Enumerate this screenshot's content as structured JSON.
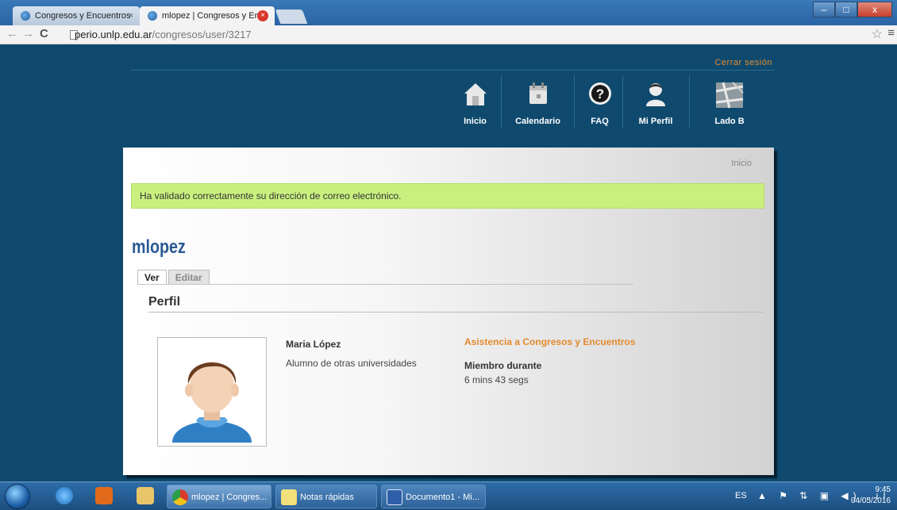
{
  "browser": {
    "tabs": [
      {
        "title": "Congresos y Encuentros",
        "close": "×"
      },
      {
        "title": "mlopez | Congresos y Enc",
        "close": "×"
      }
    ],
    "window_controls": {
      "minimize": "–",
      "maximize": "□",
      "close": "x"
    },
    "nav": {
      "back": "←",
      "forward": "→",
      "reload": "C"
    },
    "url_host": "perio.unlp.edu.ar",
    "url_path": "/congresos/user/3217",
    "star": "☆",
    "menu": "≡"
  },
  "site": {
    "logout": "Cerrar sesión",
    "nav": [
      {
        "label": "Inicio",
        "icon": "home-icon"
      },
      {
        "label": "Calendario",
        "icon": "calendar-icon"
      },
      {
        "label": "FAQ",
        "icon": "help-icon"
      },
      {
        "label": "Mi Perfil",
        "icon": "user-icon"
      },
      {
        "label": "Lado B",
        "icon": "map-icon"
      }
    ],
    "breadcrumb": "Inicio",
    "message": "Ha validado correctamente su dirección de correo electrónico.",
    "username": "mlopez",
    "tabs": {
      "ver": "Ver",
      "editar": "Editar"
    },
    "section_title": "Perfil",
    "profile": {
      "full_name": "Maria López",
      "role": "Alumno de otras universidades",
      "assistance_title": "Asistencia a Congresos y Encuentros",
      "member_label": "Miembro durante",
      "member_value": "6 mins 43 segs"
    }
  },
  "taskbar": {
    "tasks": [
      {
        "label": "mlopez | Congres..."
      },
      {
        "label": "Notas rápidas"
      },
      {
        "label": "Documento1 - Mi..."
      }
    ],
    "lang": "ES",
    "tray": "▲ ⚑ ⇅ ▣ ◀) .ıl",
    "time": "9:45",
    "date": "04/05/2016"
  },
  "colors": {
    "site_bg": "#0f4a6e",
    "accent_orange": "#e48a2e",
    "success_bg": "#c9f07f",
    "username_blue": "#2a5a92"
  }
}
